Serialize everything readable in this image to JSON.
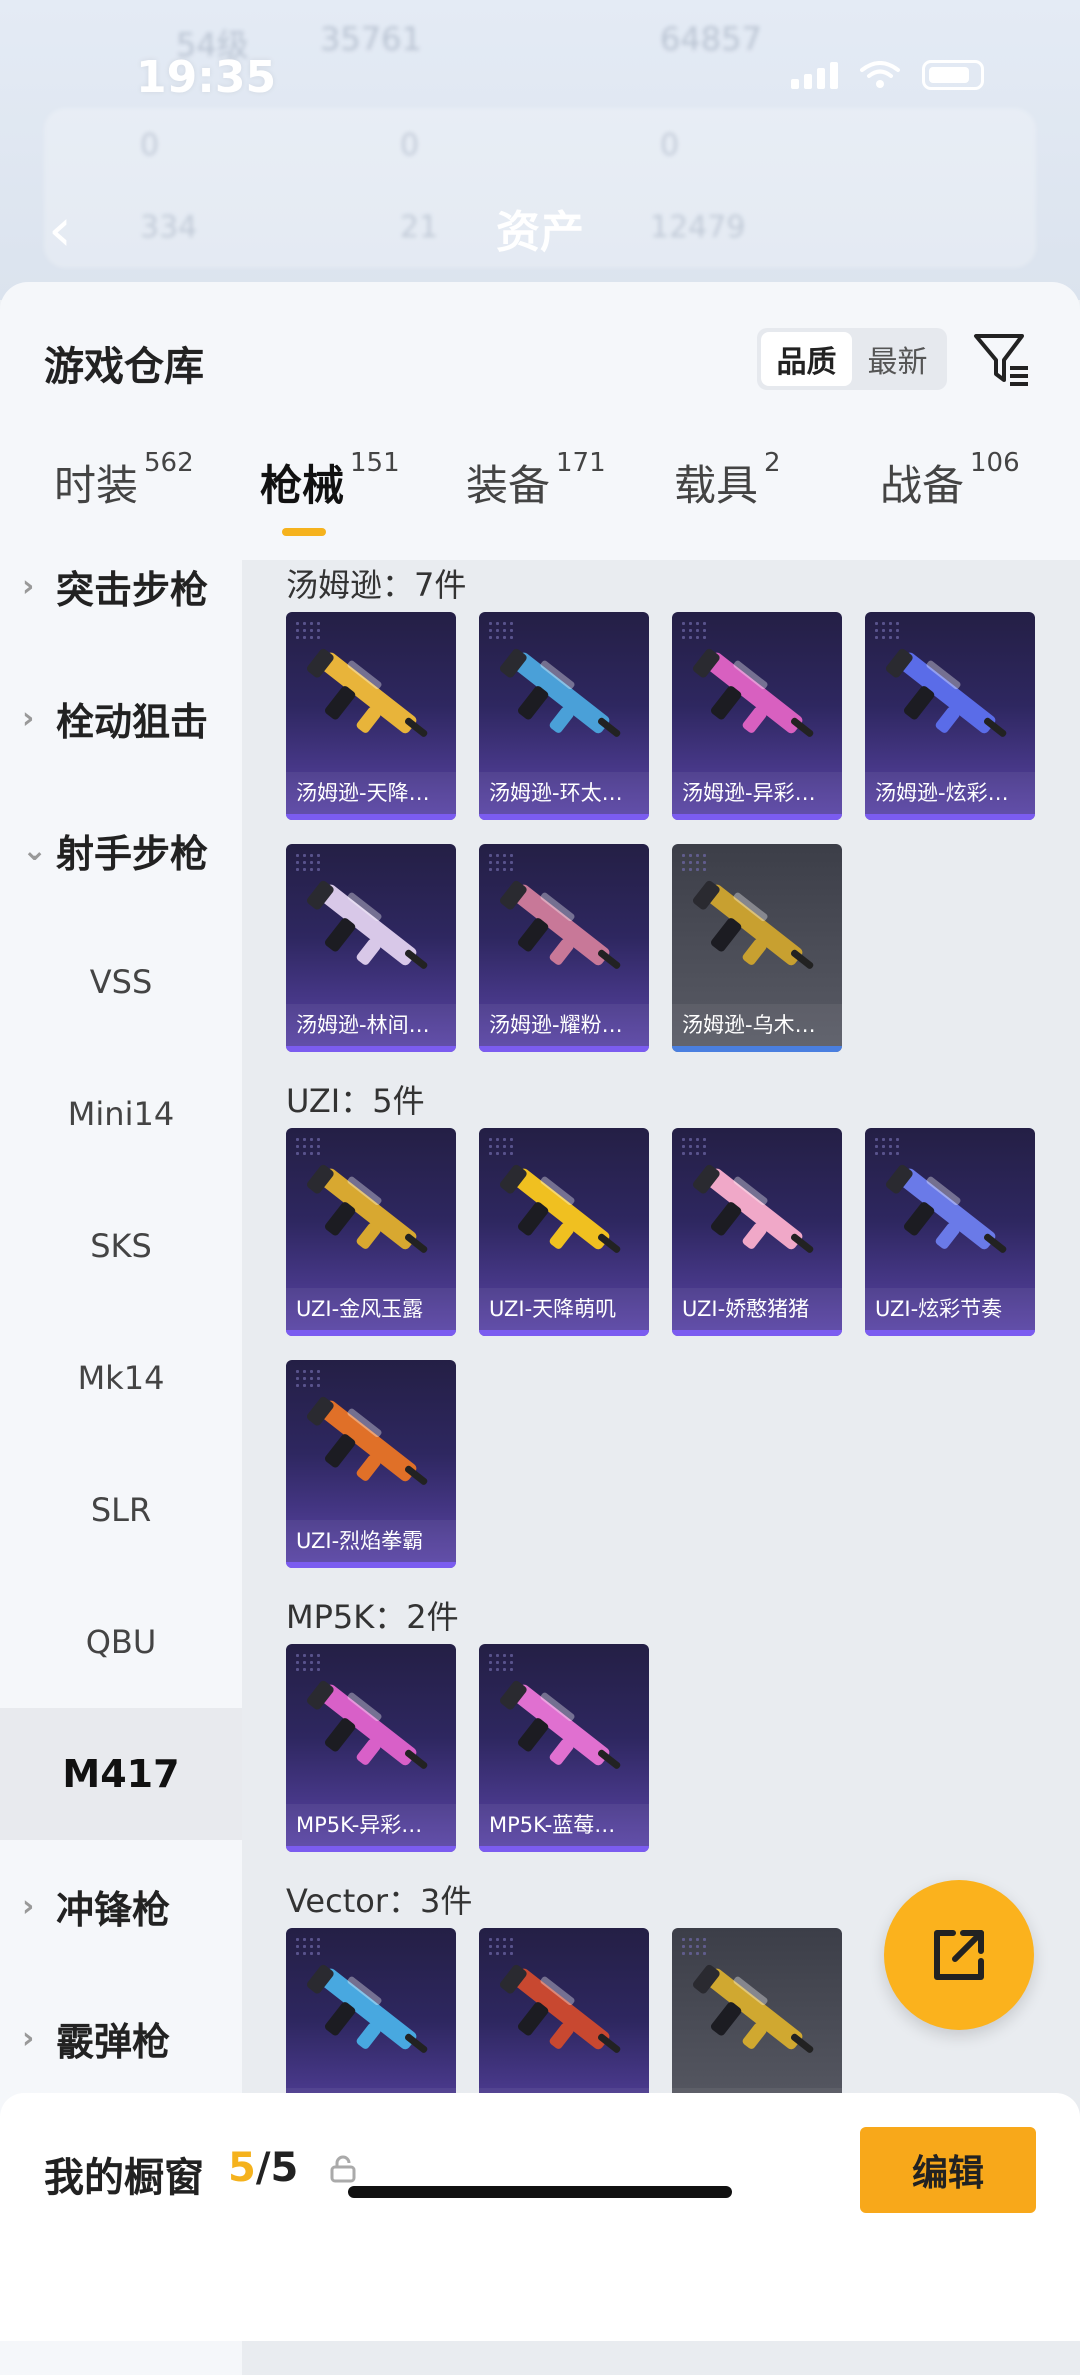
{
  "status_bar": {
    "time": "19:35"
  },
  "background_header": {
    "level": "54级",
    "coins_a": "35761",
    "coins_b": "64857",
    "stat_1": "0",
    "stat_2": "0",
    "stat_3": "0",
    "stat_4": "334",
    "stat_5": "21",
    "stat_6": "12479",
    "title": "资产"
  },
  "panel": {
    "title": "游戏仓库",
    "sort_options": [
      "品质",
      "最新"
    ],
    "sort_active": "品质"
  },
  "tabs": [
    {
      "label": "时装",
      "count": "562"
    },
    {
      "label": "枪械",
      "count": "151"
    },
    {
      "label": "装备",
      "count": "171"
    },
    {
      "label": "载具",
      "count": "2"
    },
    {
      "label": "战备",
      "count": "106"
    }
  ],
  "active_tab": "枪械",
  "sidebar": {
    "items": [
      {
        "label": "突击步枪",
        "type": "category",
        "chevron": "›"
      },
      {
        "label": "栓动狙击",
        "type": "category",
        "chevron": "›"
      },
      {
        "label": "射手步枪",
        "type": "category",
        "chevron": "⌄"
      },
      {
        "label": "VSS",
        "type": "sub"
      },
      {
        "label": "Mini14",
        "type": "sub"
      },
      {
        "label": "SKS",
        "type": "sub"
      },
      {
        "label": "Mk14",
        "type": "sub"
      },
      {
        "label": "SLR",
        "type": "sub"
      },
      {
        "label": "QBU",
        "type": "sub"
      },
      {
        "label": "M417",
        "type": "sub",
        "selected": true
      },
      {
        "label": "冲锋枪",
        "type": "category",
        "chevron": "›"
      },
      {
        "label": "霰弹枪",
        "type": "category",
        "chevron": "›"
      }
    ]
  },
  "groups": [
    {
      "title": "汤姆逊：7件",
      "items": [
        {
          "name": "汤姆逊-天降…",
          "color": "#e8b43a"
        },
        {
          "name": "汤姆逊-环太…",
          "color": "#4aa0d8"
        },
        {
          "name": "汤姆逊-异彩…",
          "color": "#d860c0"
        },
        {
          "name": "汤姆逊-炫彩…",
          "color": "#5a6ce8"
        },
        {
          "name": "汤姆逊-林间…",
          "color": "#d8c8e8"
        },
        {
          "name": "汤姆逊-耀粉…",
          "color": "#c87898"
        },
        {
          "name": "汤姆逊-乌木…",
          "color": "#c8a030",
          "gray": true
        }
      ]
    },
    {
      "title": "UZI：5件",
      "items": [
        {
          "name": "UZI-金风玉露",
          "color": "#d8a830"
        },
        {
          "name": "UZI-天降萌叽",
          "color": "#f0c020"
        },
        {
          "name": "UZI-娇憨猪猪",
          "color": "#f0a8c8"
        },
        {
          "name": "UZI-炫彩节奏",
          "color": "#6a7ae8"
        },
        {
          "name": "UZI-烈焰拳霸",
          "color": "#e07028"
        }
      ]
    },
    {
      "title": "MP5K：2件",
      "items": [
        {
          "name": "MP5K-异彩…",
          "color": "#d860c8"
        },
        {
          "name": "MP5K-蓝莓…",
          "color": "#e070d0"
        }
      ]
    },
    {
      "title": "Vector：3件",
      "items": [
        {
          "name": "",
          "color": "#48a8e0"
        },
        {
          "name": "",
          "color": "#c84830"
        },
        {
          "name": "",
          "color": "#d0a830",
          "gray": true
        }
      ]
    }
  ],
  "bottom_bar": {
    "showcase_label": "我的橱窗",
    "showcase_current": "5",
    "showcase_total": "/5",
    "edit_label": "编辑"
  },
  "colors": {
    "accent": "#f5b21d",
    "item_bg": "#2e2760",
    "rarity_bar": "#7b5cf0"
  }
}
